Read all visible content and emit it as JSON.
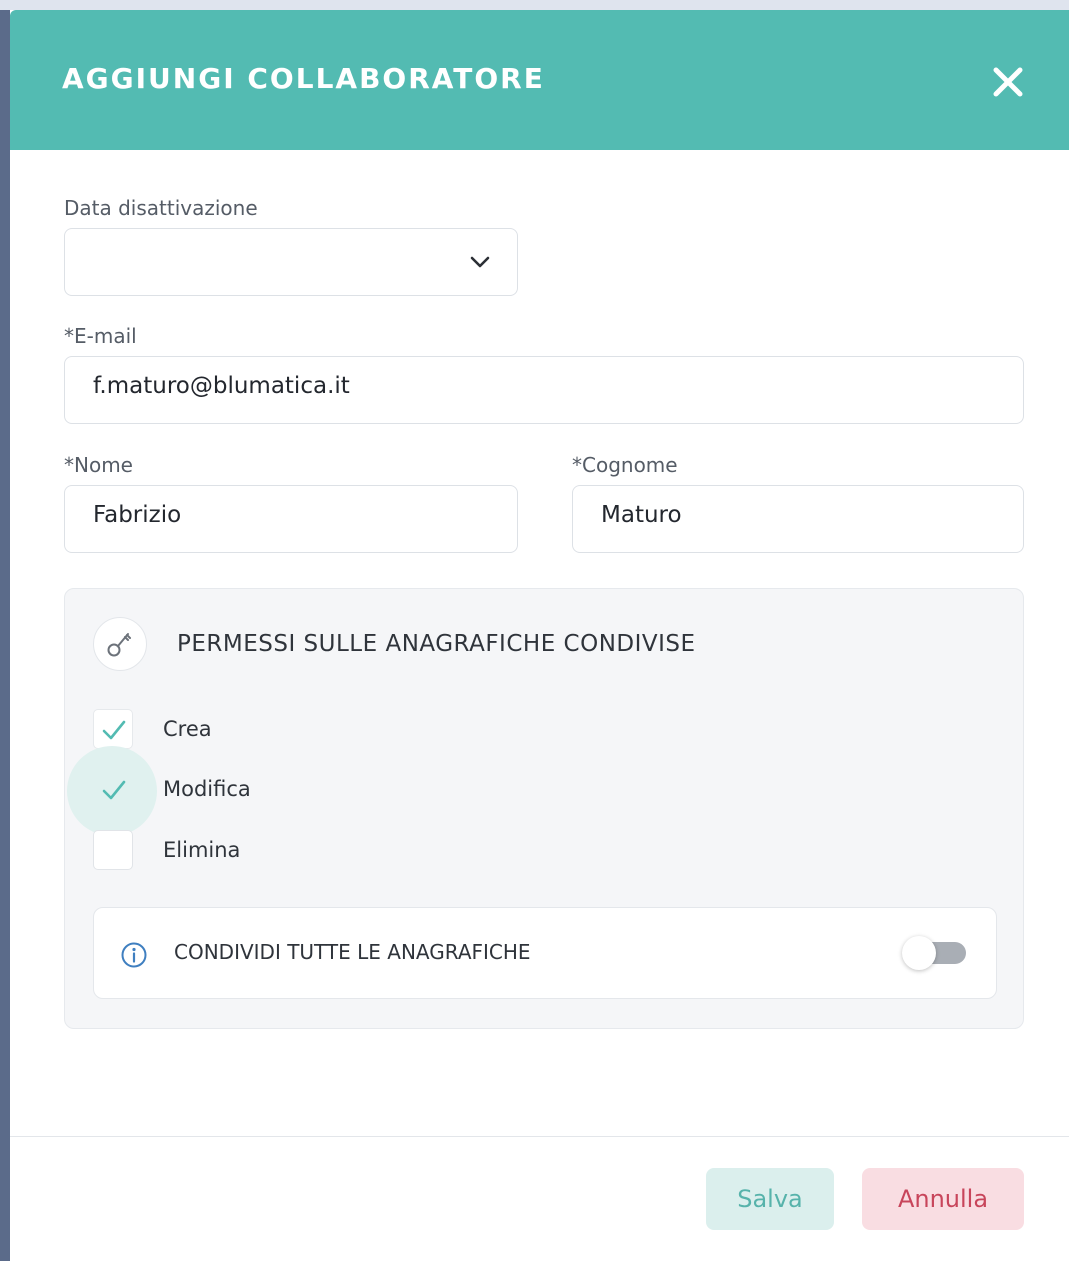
{
  "modal": {
    "title": "AGGIUNGI COLLABORATORE",
    "close_icon": "close-icon",
    "accent_color": "#53bbb2"
  },
  "form": {
    "deactivation_date": {
      "label": "Data disattivazione",
      "value": ""
    },
    "email": {
      "label": "*E-mail",
      "value": "f.maturo@blumatica.it"
    },
    "first_name": {
      "label": "*Nome",
      "value": "Fabrizio"
    },
    "last_name": {
      "label": "*Cognome",
      "value": "Maturo"
    }
  },
  "permissions": {
    "icon": "key-icon",
    "title": "PERMESSI SULLE ANAGRAFICHE CONDIVISE",
    "items": [
      {
        "label": "Crea",
        "checked": true
      },
      {
        "label": "Modifica",
        "checked": true,
        "focused": true
      },
      {
        "label": "Elimina",
        "checked": false
      }
    ],
    "share_all": {
      "icon": "info-icon",
      "label": "CONDIVIDI TUTTE LE ANAGRAFICHE",
      "enabled": false
    }
  },
  "footer": {
    "save_label": "Salva",
    "cancel_label": "Annulla",
    "save_color": "#57b3ab",
    "cancel_color": "#c8455b"
  }
}
